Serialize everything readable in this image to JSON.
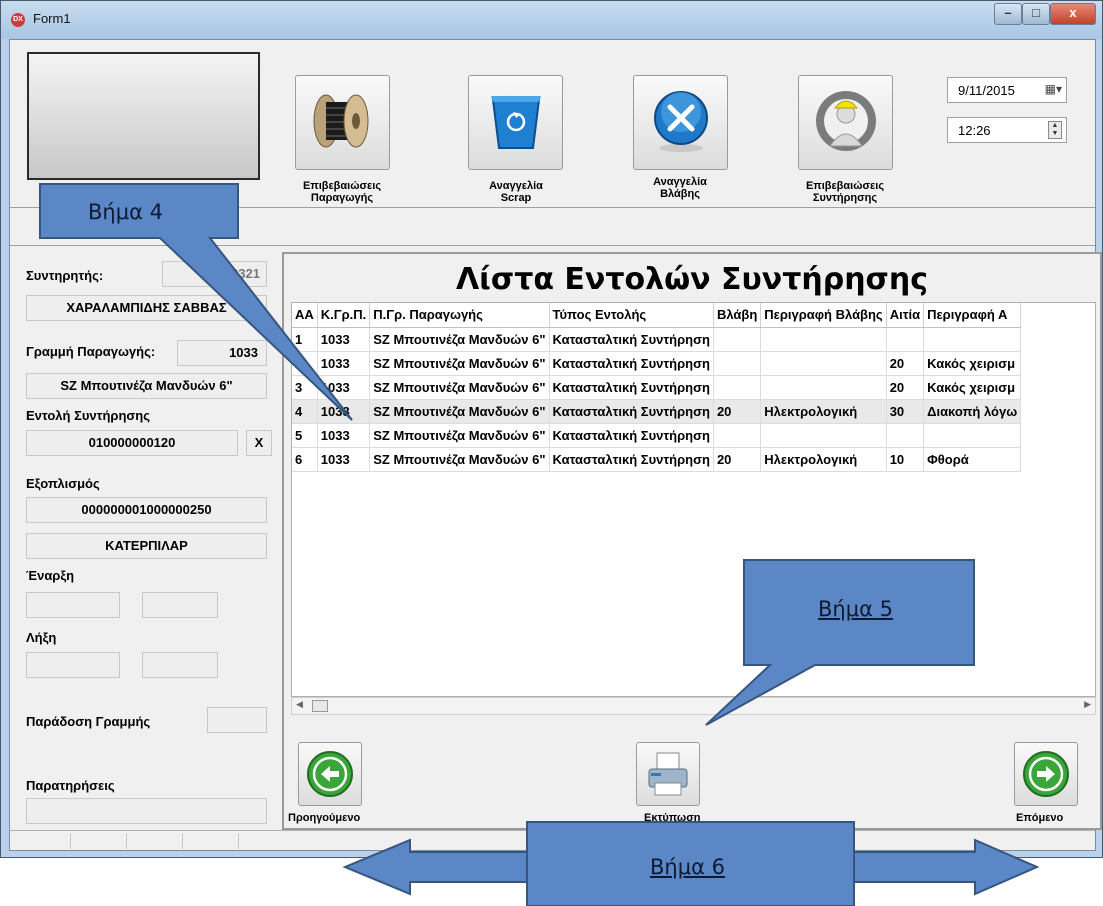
{
  "window": {
    "title": "Form1",
    "min": "–",
    "max": "□",
    "close": "x"
  },
  "toolbar": {
    "buttons": [
      {
        "line1": "Επιβεβαιώσεις",
        "line2": "Παραγωγής",
        "icon": "cable-reel-icon"
      },
      {
        "line1": "Αναγγελία",
        "line2": "Scrap",
        "icon": "recycle-bin-icon"
      },
      {
        "line1": "Αναγγελία",
        "line2": "Βλάβης",
        "icon": "tools-icon"
      },
      {
        "line1": "Επιβεβαιώσεις",
        "line2": "Συντήρησης",
        "icon": "technician-icon"
      }
    ],
    "date": "9/11/2015",
    "time": "12:26"
  },
  "left": {
    "technician_label": "Συντηρητής:",
    "technician_id": "00100321",
    "technician_name": "ΧΑΡΑΛΑΜΠΙΔΗΣ ΣΑΒΒΑΣ",
    "line_label": "Γραμμή Παραγωγής:",
    "line_value": "1033",
    "line_name": "SZ Μπουτινέζα Μανδυών 6\"",
    "order_label": "Εντολή Συντήρησης",
    "order_value": "010000000120",
    "clear_label": "X",
    "equipment_label": "Εξοπλισμός",
    "equipment_value": "000000001000000250",
    "equipment_name": "ΚΑΤΕΡΠΙΛΑΡ",
    "start_label": "Έναρξη",
    "end_label": "Λήξη",
    "handover_label": "Παράδοση Γραμμής",
    "notes_label": "Παρατηρήσεις"
  },
  "main": {
    "title": "Λίστα Εντολών Συντήρησης",
    "columns": [
      "ΑΑ",
      "Κ.Γρ.Π.",
      "Π.Γρ. Παραγωγής",
      "Τύπος Εντολής",
      "Βλάβη",
      "Περιγραφή Βλάβης",
      "Αιτία",
      "Περιγραφή Α"
    ],
    "rows": [
      [
        "1",
        "1033",
        "SZ Μπουτινέζα Μανδυών 6\"",
        "Κατασταλτική Συντήρηση",
        "",
        "",
        "",
        ""
      ],
      [
        "2",
        "1033",
        "SZ Μπουτινέζα Μανδυών 6\"",
        "Κατασταλτική Συντήρηση",
        "",
        "",
        "20",
        "Κακός χειρισμ"
      ],
      [
        "3",
        "1033",
        "SZ Μπουτινέζα Μανδυών 6\"",
        "Κατασταλτική Συντήρηση",
        "",
        "",
        "20",
        "Κακός χειρισμ"
      ],
      [
        "4",
        "1033",
        "SZ Μπουτινέζα Μανδυών 6\"",
        "Κατασταλτική Συντήρηση",
        "20",
        "Ηλεκτρολογική",
        "30",
        "Διακοπή λόγω"
      ],
      [
        "5",
        "1033",
        "SZ Μπουτινέζα Μανδυών 6\"",
        "Κατασταλτική Συντήρηση",
        "",
        "",
        "",
        ""
      ],
      [
        "6",
        "1033",
        "SZ Μπουτινέζα Μανδυών 6\"",
        "Κατασταλτική Συντήρηση",
        "20",
        "Ηλεκτρολογική",
        "10",
        "Φθορά"
      ]
    ],
    "selected_row": 3,
    "prev_label": "Προηγούμενο",
    "print_label": "Εκτύπωση",
    "next_label": "Επόμενο"
  },
  "callouts": {
    "step4": "Βήμα 4",
    "step5": "Βήμα 5",
    "step6": "Βήμα 6"
  },
  "colors": {
    "callout_fill": "#5b87c6",
    "callout_border": "#36557f",
    "green": "#3aa63a"
  }
}
